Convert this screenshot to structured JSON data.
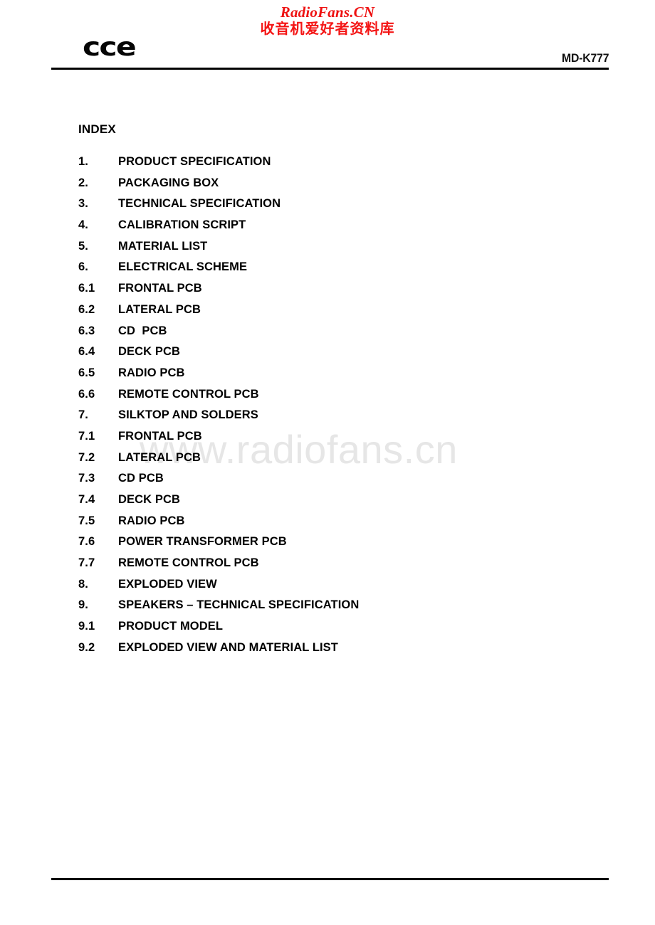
{
  "watermarks": {
    "top_latin": "RadioFans.CN",
    "top_cjk": "收音机爱好者资料库",
    "body": "www.radiofans.cn",
    "top_color": "#ee1111",
    "body_color": "#e6e6e6"
  },
  "header": {
    "brand": "cce",
    "model": "MD-K777"
  },
  "index": {
    "heading": "INDEX",
    "items": [
      {
        "number": "1.",
        "label": "PRODUCT SPECIFICATION"
      },
      {
        "number": "2.",
        "label": "PACKAGING BOX"
      },
      {
        "number": "3.",
        "label": "TECHNICAL SPECIFICATION"
      },
      {
        "number": "4.",
        "label": "CALIBRATION SCRIPT"
      },
      {
        "number": "5.",
        "label": "MATERIAL LIST"
      },
      {
        "number": "6.",
        "label": "ELECTRICAL SCHEME"
      },
      {
        "number": "6.1",
        "label": "FRONTAL PCB"
      },
      {
        "number": "6.2",
        "label": "LATERAL PCB"
      },
      {
        "number": "6.3",
        "label": "CD  PCB"
      },
      {
        "number": "6.4",
        "label": "DECK PCB"
      },
      {
        "number": "6.5",
        "label": "RADIO PCB"
      },
      {
        "number": "6.6",
        "label": "REMOTE CONTROL PCB"
      },
      {
        "number": "7.",
        "label": "SILKTOP AND SOLDERS"
      },
      {
        "number": "7.1",
        "label": "FRONTAL PCB"
      },
      {
        "number": "7.2",
        "label": "LATERAL PCB"
      },
      {
        "number": "7.3",
        "label": "CD PCB"
      },
      {
        "number": "7.4",
        "label": "DECK PCB"
      },
      {
        "number": "7.5",
        "label": "RADIO PCB"
      },
      {
        "number": "7.6",
        "label": "POWER TRANSFORMER PCB"
      },
      {
        "number": "7.7",
        "label": "REMOTE CONTROL PCB"
      },
      {
        "number": "8.",
        "label": "EXPLODED VIEW"
      },
      {
        "number": "9.",
        "label": "SPEAKERS – TECHNICAL SPECIFICATION"
      },
      {
        "number": "9.1",
        "label": "PRODUCT MODEL"
      },
      {
        "number": "9.2",
        "label": "EXPLODED VIEW AND MATERIAL LIST"
      }
    ]
  }
}
